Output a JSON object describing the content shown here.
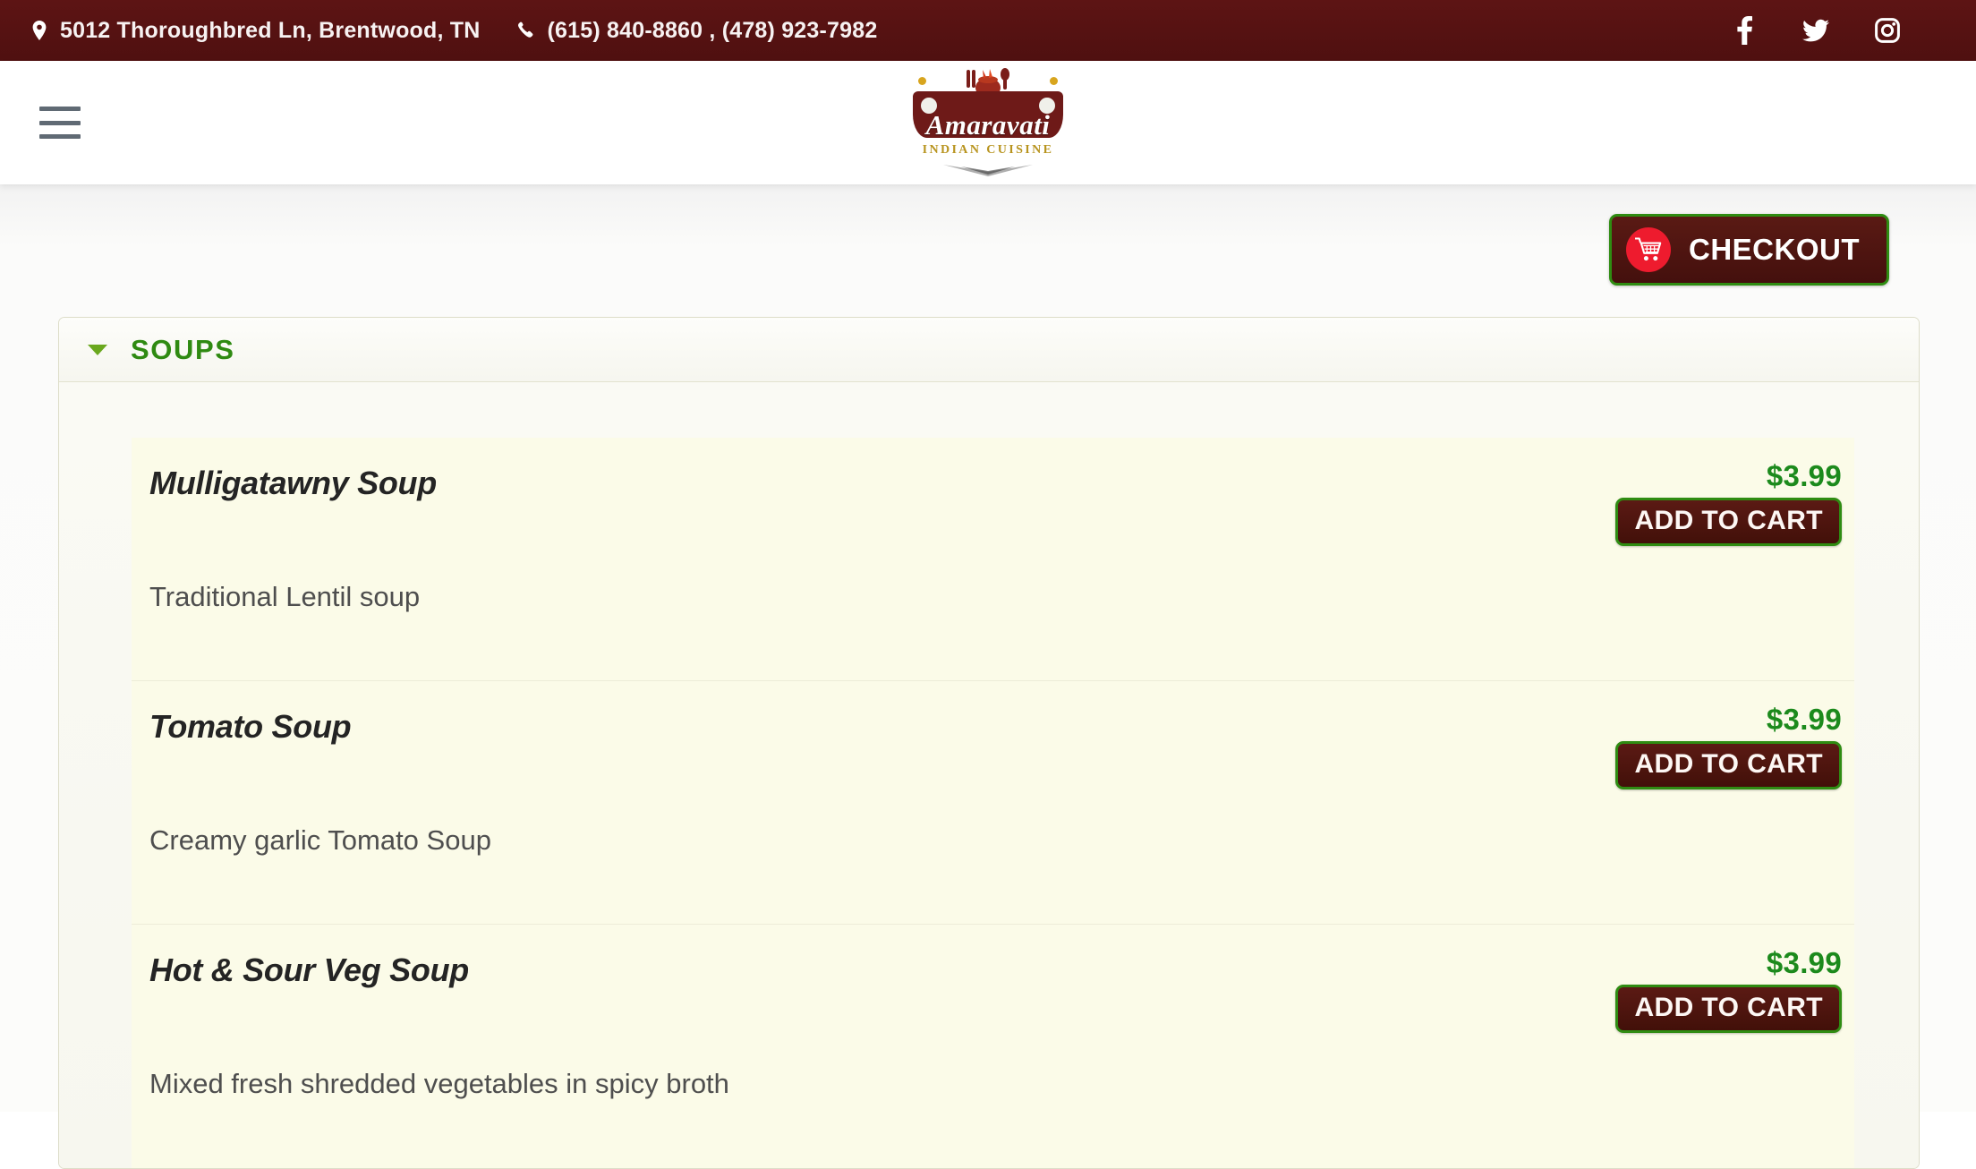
{
  "topbar": {
    "address": "5012 Thoroughbred Ln, Brentwood, TN",
    "phones": "(615) 840-8860 , (478) 923-7982",
    "address_icon": "map-pin-icon",
    "phone_icon": "phone-icon",
    "social": [
      {
        "name": "facebook-icon",
        "label": "Facebook"
      },
      {
        "name": "twitter-icon",
        "label": "Twitter"
      },
      {
        "name": "instagram-icon",
        "label": "Instagram"
      }
    ],
    "bg_color": "#551212",
    "text_color": "#f7f2f2"
  },
  "header": {
    "menu_icon": "hamburger-menu-icon",
    "logo_word": "Amaravati",
    "logo_sub": "INDIAN CUISINE"
  },
  "toolbar": {
    "checkout_label": "CHECKOUT",
    "cart_icon": "shopping-cart-icon",
    "button_bg": "#4d1410",
    "button_border": "#2f8c12",
    "cart_badge_color": "#ee1b2e"
  },
  "category": {
    "title": "SOUPS",
    "expanded": true,
    "chevron_icon": "chevron-down-icon",
    "title_color": "#2f8a12"
  },
  "menu": {
    "add_to_cart_label": "ADD TO CART",
    "price_color": "#1c8a1c",
    "items": [
      {
        "name": "Mulligatawny Soup",
        "description": "Traditional Lentil soup",
        "price": "$3.99"
      },
      {
        "name": "Tomato Soup",
        "description": "Creamy garlic Tomato Soup",
        "price": "$3.99"
      },
      {
        "name": "Hot & Sour Veg Soup",
        "description": "Mixed fresh shredded vegetables in spicy broth",
        "price": "$3.99"
      }
    ]
  }
}
